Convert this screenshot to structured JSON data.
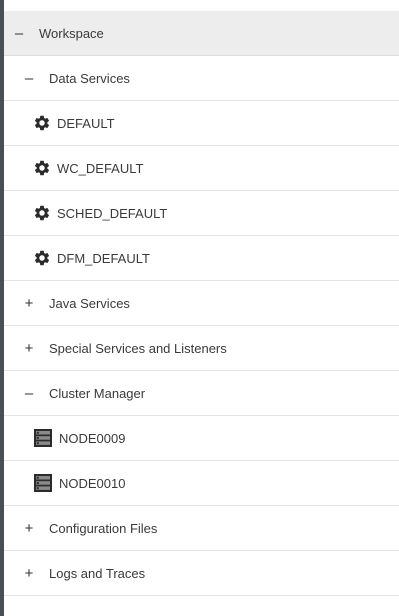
{
  "tree": {
    "root": {
      "toggle": "–",
      "label": "Workspace"
    },
    "data_services": {
      "toggle": "–",
      "label": "Data Services"
    },
    "data_services_items": [
      {
        "label": "DEFAULT",
        "icon": "gear-icon"
      },
      {
        "label": "WC_DEFAULT",
        "icon": "gear-icon"
      },
      {
        "label": "SCHED_DEFAULT",
        "icon": "gear-icon"
      },
      {
        "label": "DFM_DEFAULT",
        "icon": "gear-icon"
      }
    ],
    "java_services": {
      "toggle": "+",
      "label": "Java Services"
    },
    "special_services": {
      "toggle": "+",
      "label": "Special Services and Listeners"
    },
    "cluster_manager": {
      "toggle": "–",
      "label": "Cluster Manager"
    },
    "cluster_nodes": [
      {
        "label": "NODE0009",
        "icon": "server-icon"
      },
      {
        "label": "NODE0010",
        "icon": "server-icon"
      }
    ],
    "configuration_files": {
      "toggle": "+",
      "label": "Configuration Files"
    },
    "logs_and_traces": {
      "toggle": "+",
      "label": "Logs and Traces"
    }
  },
  "colors": {
    "root_bg": "#ededed",
    "border_left": "#4a4f54",
    "icon": "#2b2b2b"
  }
}
